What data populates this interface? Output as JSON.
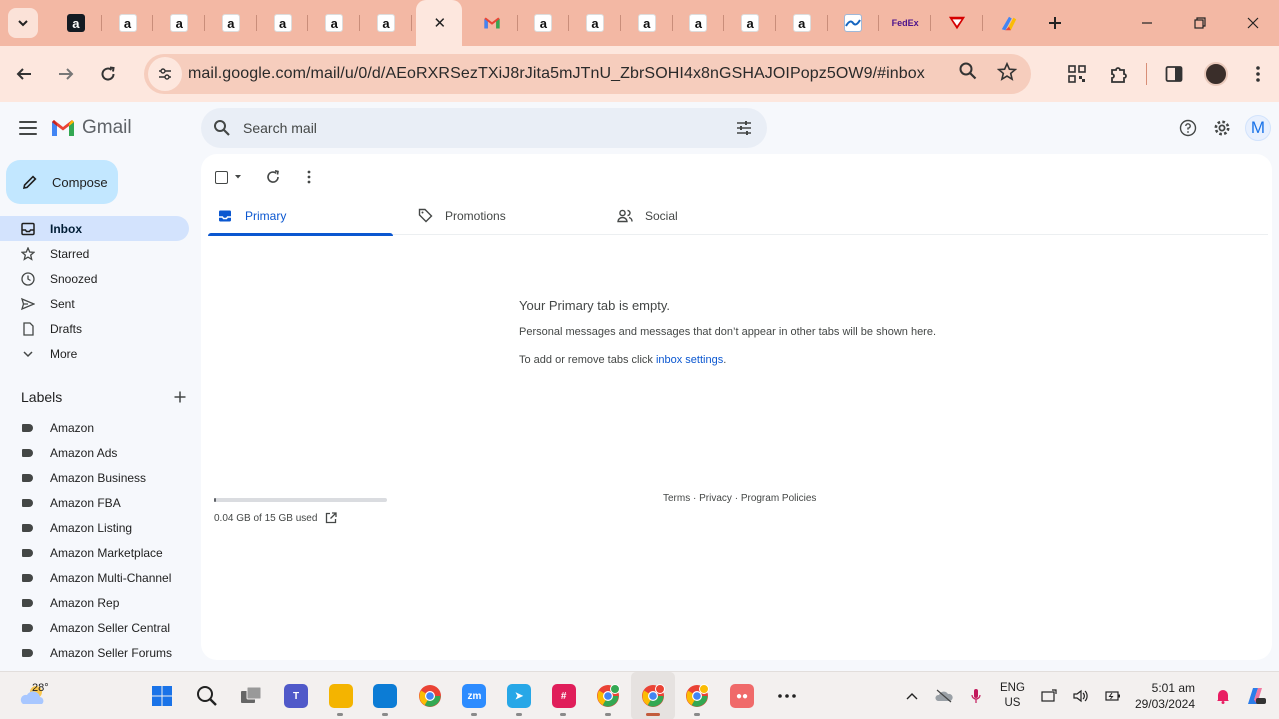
{
  "browser": {
    "tabs": [
      {
        "icon": "amazon-dark-icon",
        "glyph": "a"
      },
      {
        "icon": "amazon-icon",
        "glyph": "a"
      },
      {
        "icon": "amazon-icon",
        "glyph": "a"
      },
      {
        "icon": "amazon-icon",
        "glyph": "a"
      },
      {
        "icon": "amazon-icon",
        "glyph": "a"
      },
      {
        "icon": "amazon-icon",
        "glyph": "a"
      },
      {
        "icon": "amazon-icon",
        "glyph": "a"
      },
      {
        "icon": "active-tab-close",
        "glyph": "✕"
      },
      {
        "icon": "gmail-icon",
        "glyph": "M"
      },
      {
        "icon": "amazon-icon",
        "glyph": "a"
      },
      {
        "icon": "amazon-icon",
        "glyph": "a"
      },
      {
        "icon": "amazon-icon",
        "glyph": "a"
      },
      {
        "icon": "amazon-icon",
        "glyph": "a"
      },
      {
        "icon": "amazon-icon",
        "glyph": "a"
      },
      {
        "icon": "amazon-icon",
        "glyph": "a"
      },
      {
        "icon": "blue-logo-icon",
        "glyph": ""
      },
      {
        "icon": "fedex-icon",
        "glyph": "FedEx"
      },
      {
        "icon": "red-triangle-icon",
        "glyph": ""
      },
      {
        "icon": "colorful-extension-icon",
        "glyph": ""
      }
    ],
    "url": "mail.google.com/mail/u/0/d/AEoRXRSezTXiJ8rJita5mJTnU_ZbrSOHI4x8nGSHAJOIPopz5OW9/#inbox",
    "accent_color": "#f3b8a4"
  },
  "gmail": {
    "logo_text": "Gmail",
    "search": {
      "placeholder": "Search mail"
    },
    "avatar_letter": "M",
    "compose_label": "Compose",
    "nav": [
      {
        "label": "Inbox",
        "icon": "inbox-icon",
        "active": true
      },
      {
        "label": "Starred",
        "icon": "star-icon",
        "active": false
      },
      {
        "label": "Snoozed",
        "icon": "clock-icon",
        "active": false
      },
      {
        "label": "Sent",
        "icon": "send-icon",
        "active": false
      },
      {
        "label": "Drafts",
        "icon": "draft-icon",
        "active": false
      },
      {
        "label": "More",
        "icon": "chevron-down-icon",
        "active": false
      }
    ],
    "labels_title": "Labels",
    "labels": [
      "Amazon",
      "Amazon Ads",
      "Amazon Business",
      "Amazon FBA",
      "Amazon Listing",
      "Amazon Marketplace",
      "Amazon Multi-Channel",
      "Amazon Rep",
      "Amazon Seller Central",
      "Amazon Seller Forums"
    ],
    "tabs": [
      {
        "label": "Primary",
        "icon": "inbox-icon",
        "active": true
      },
      {
        "label": "Promotions",
        "icon": "tag-icon",
        "active": false
      },
      {
        "label": "Social",
        "icon": "people-icon",
        "active": false
      }
    ],
    "empty": {
      "title": "Your Primary tab is empty.",
      "line1": "Personal messages and messages that don’t appear in other tabs will be shown here.",
      "line2_prefix": "To add or remove tabs click ",
      "line2_link": "inbox settings",
      "line2_suffix": "."
    },
    "storage": {
      "text": "0.04 GB of 15 GB used",
      "fraction_used": 0.003
    },
    "footer": {
      "terms": "Terms",
      "privacy": "Privacy",
      "policies": "Program Policies",
      "sep": " · "
    }
  },
  "taskbar": {
    "temperature": "28°",
    "apps": [
      {
        "name": "start-icon",
        "label": "",
        "color": "#1a73e8",
        "running": false,
        "focus": false
      },
      {
        "name": "search-icon",
        "label": "",
        "color": "",
        "running": false,
        "focus": false
      },
      {
        "name": "task-view-icon",
        "label": "",
        "color": "",
        "running": false,
        "focus": false
      },
      {
        "name": "teams-icon",
        "label": "T",
        "color": "#5059c9",
        "running": false,
        "focus": false
      },
      {
        "name": "file-explorer-icon",
        "label": "",
        "color": "#f4b400",
        "running": true,
        "focus": false
      },
      {
        "name": "edge-icon",
        "label": "",
        "color": "#0c7cd5",
        "running": true,
        "focus": false
      },
      {
        "name": "chrome-icon",
        "label": "",
        "color": "#34a853",
        "running": false,
        "focus": false
      },
      {
        "name": "zoom-icon",
        "label": "zm",
        "color": "#2d8cff",
        "running": true,
        "focus": false
      },
      {
        "name": "telegram-icon",
        "label": "➤",
        "color": "#27a7e7",
        "running": true,
        "focus": false
      },
      {
        "name": "slack-icon",
        "label": "#",
        "color": "#e01e5a",
        "running": true,
        "focus": false
      },
      {
        "name": "chrome-profile-1-icon",
        "label": "",
        "color": "#34a853",
        "running": true,
        "focus": false
      },
      {
        "name": "chrome-profile-2-icon",
        "label": "",
        "color": "#ea4335",
        "running": true,
        "focus": true
      },
      {
        "name": "chrome-profile-3-icon",
        "label": "",
        "color": "#fbbc04",
        "running": true,
        "focus": false
      },
      {
        "name": "asana-icon",
        "label": "●●",
        "color": "#f06a6a",
        "running": false,
        "focus": false
      },
      {
        "name": "more-apps-icon",
        "label": "···",
        "color": "",
        "running": false,
        "focus": false
      }
    ],
    "lang_top": "ENG",
    "lang_bottom": "US",
    "time": "5:01 am",
    "date": "29/03/2024"
  }
}
